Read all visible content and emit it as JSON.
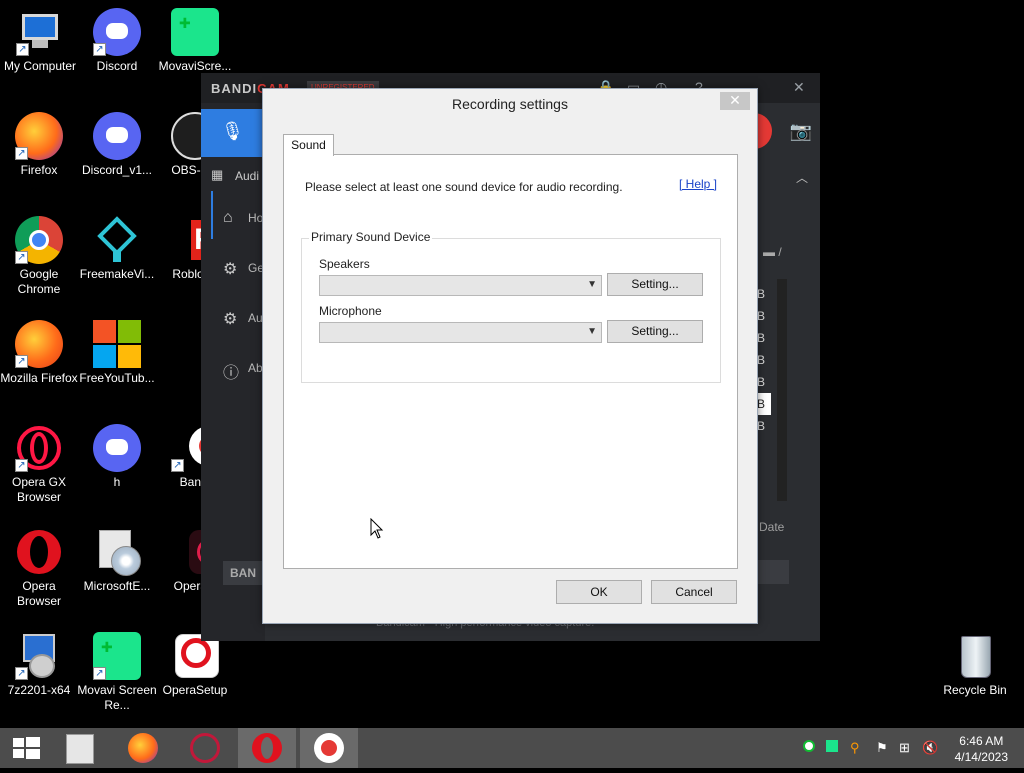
{
  "desktop_icons": [
    {
      "label": "My Computer",
      "icon": "computer-icon"
    },
    {
      "label": "Discord",
      "icon": "discord-icon"
    },
    {
      "label": "MovaviScre...",
      "icon": "movavi-icon"
    },
    {
      "label": "Firefox",
      "icon": "firefox-icon"
    },
    {
      "label": "Discord_v1...",
      "icon": "discord-icon"
    },
    {
      "label": "OBS-Stu",
      "icon": "obs-icon"
    },
    {
      "label": "Google Chrome",
      "icon": "chrome-icon"
    },
    {
      "label": "FreemakeVi...",
      "icon": "freemake-icon"
    },
    {
      "label": "RobloxS",
      "icon": "roblox-icon"
    },
    {
      "label": "Mozilla Firefox",
      "icon": "firefox-icon"
    },
    {
      "label": "FreeYouTub...",
      "icon": "freeyoutube-icon"
    },
    {
      "label": "Opera GX Browser",
      "icon": "opera-gx-icon"
    },
    {
      "label": "h",
      "icon": "discord-icon"
    },
    {
      "label": "Bandi",
      "icon": "bandicam-icon"
    },
    {
      "label": "Opera Browser",
      "icon": "opera-icon"
    },
    {
      "label": "MicrosoftE...",
      "icon": "installer-icon"
    },
    {
      "label": "OperaG",
      "icon": "opera-gx-icon"
    },
    {
      "label": "7z2201-x64",
      "icon": "installer-icon"
    },
    {
      "label": "Movavi Screen Re...",
      "icon": "movavi-icon"
    },
    {
      "label": "OperaSetup",
      "icon": "opera-setup-icon"
    },
    {
      "label": "Recycle Bin",
      "icon": "recycle-bin-icon"
    }
  ],
  "bandicam": {
    "brand_prefix": "BANDI",
    "brand_suffix": "CAM",
    "unregistered": "UNREGISTERED",
    "mode_label": "Audi",
    "sidebar": [
      "Ho",
      "Ge",
      "Au",
      "Ab"
    ],
    "file_sizes": [
      "B",
      "B",
      "B",
      "B",
      "B",
      "B",
      "B",
      "B"
    ],
    "date_header": "Date",
    "bottom_button": "BAN",
    "footer": "Bandicam - High performance video capture."
  },
  "dialog": {
    "title": "Recording settings",
    "close_glyph": "✕",
    "tab": "Sound",
    "instruction": "Please select at least one sound device for audio recording.",
    "help_link": "[ Help ]",
    "group_title": "Primary Sound Device",
    "speakers_label": "Speakers",
    "speakers_value": "",
    "speakers_setting": "Setting...",
    "microphone_label": "Microphone",
    "microphone_value": "",
    "microphone_setting": "Setting...",
    "ok": "OK",
    "cancel": "Cancel"
  },
  "taskbar": {
    "items": [
      "start-icon",
      "installer-icon",
      "firefox-icon",
      "opera-gx-icon",
      "opera-icon",
      "bandicam-icon"
    ],
    "clock_time": "6:46 AM",
    "clock_date": "4/14/2023"
  },
  "colors": {
    "accent": "#2e7de1",
    "record": "#e53935",
    "taskbar": "#4c4c4c"
  }
}
